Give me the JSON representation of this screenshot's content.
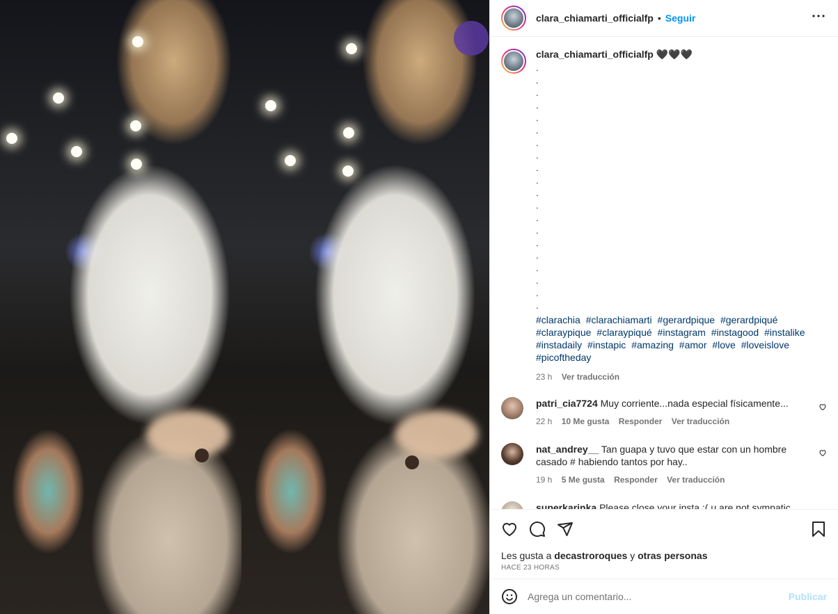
{
  "post": {
    "username": "clara_chiamarti_officialfp",
    "separator": "•",
    "follow_label": "Seguir",
    "more_label": "•••"
  },
  "caption": {
    "username": "clara_chiamarti_officialfp",
    "emoji": "🖤🖤🖤",
    "dot_lines": [
      ".",
      ".",
      ".",
      ".",
      ".",
      ".",
      ".",
      ".",
      ".",
      ".",
      ".",
      ".",
      ".",
      ".",
      ".",
      ".",
      ".",
      ".",
      ".",
      "."
    ],
    "hashtags": [
      "#clarachia",
      "#clarachiamarti",
      "#gerardpique",
      "#gerardpiqué",
      "#claraypique",
      "#claraypiqué",
      "#instagram",
      "#instagood",
      "#instalike",
      "#instadaily",
      "#instapic",
      "#amazing",
      "#amor",
      "#love",
      "#loveislove",
      "#picoftheday"
    ],
    "time": "23 h",
    "translate_label": "Ver traducción"
  },
  "comments": [
    {
      "username": "patri_cia7724",
      "text": "Muy corriente...nada especial físicamente...",
      "time": "22 h",
      "likes": "10 Me gusta",
      "reply_label": "Responder",
      "translate_label": "Ver traducción"
    },
    {
      "username": "nat_andrey__",
      "text": "Tan guapa y tuvo que estar con un hombre casado # habiendo tantos por hay..",
      "time": "19 h",
      "likes": "5 Me gusta",
      "reply_label": "Responder",
      "translate_label": "Ver traducción"
    },
    {
      "username": "superkarinka",
      "text": "Please close your insta :( u are not sympatic"
    }
  ],
  "actions": {
    "likes_prefix": "Les gusta a",
    "likes_user": "decastroroques",
    "likes_conj": "y",
    "likes_others": "otras personas",
    "time_ago": "HACE 23 HORAS"
  },
  "add_comment": {
    "placeholder": "Agrega un comentario...",
    "publish_label": "Publicar"
  },
  "icons": {
    "like": "heart-icon",
    "comment": "comment-icon",
    "share": "share-icon",
    "save": "bookmark-icon",
    "emoji": "smiley-icon"
  }
}
